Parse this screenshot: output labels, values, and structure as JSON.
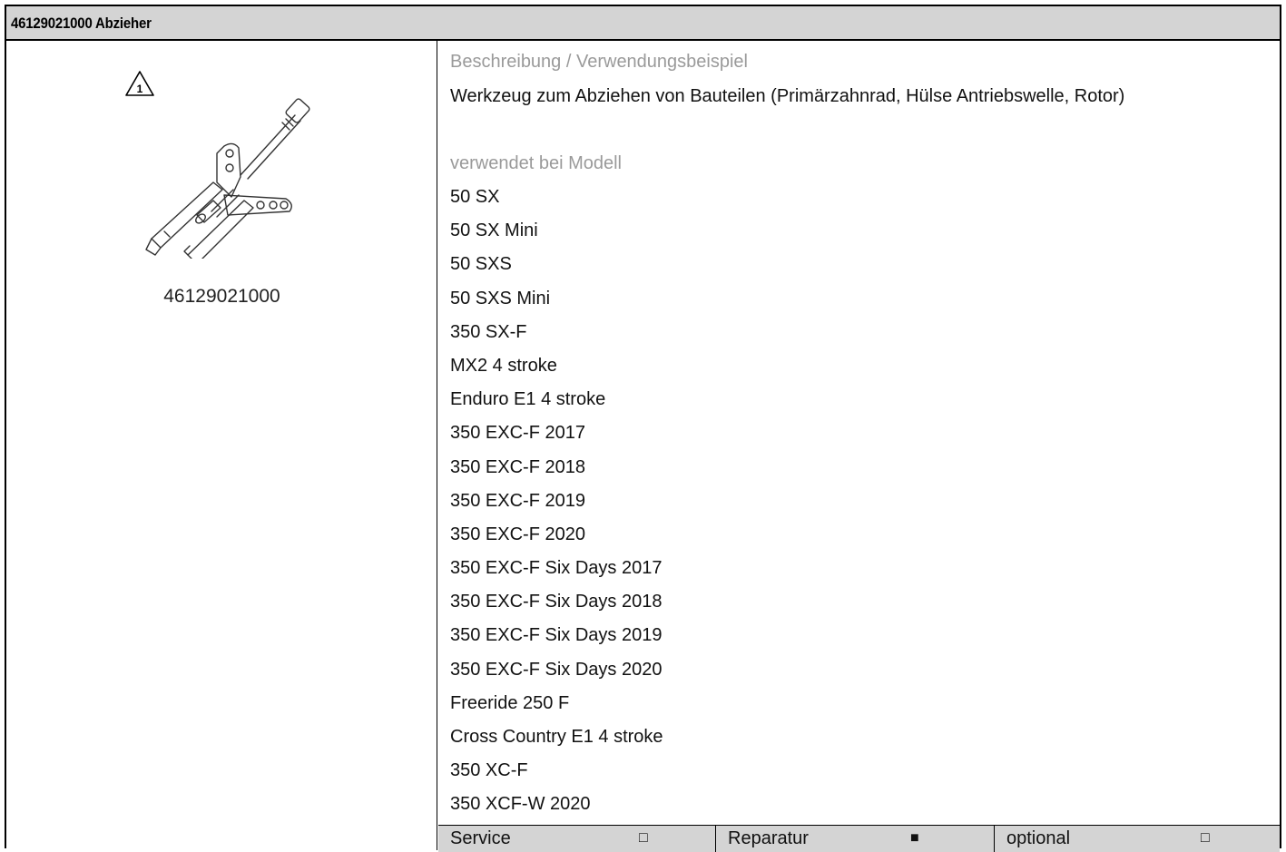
{
  "header": {
    "title": "46129021000 Abzieher"
  },
  "tool": {
    "image_icon": "puller-tool-illustration",
    "warning_icon": "warning-triangle-1-icon",
    "warning_number": "1",
    "part_number": "46129021000"
  },
  "description": {
    "label": "Beschreibung / Verwendungsbeispiel",
    "text": "Werkzeug zum Abziehen von Bauteilen (Primärzahnrad, Hülse Antriebswelle, Rotor)"
  },
  "models": {
    "label": "verwendet bei Modell",
    "items": [
      "50 SX",
      "50 SX Mini",
      "50 SXS",
      "50 SXS Mini",
      "350 SX-F",
      "MX2 4 stroke",
      "Enduro E1 4 stroke",
      "350 EXC-F 2017",
      "350 EXC-F 2018",
      "350 EXC-F 2019",
      "350 EXC-F 2020",
      "350 EXC-F Six Days 2017",
      "350 EXC-F Six Days 2018",
      "350 EXC-F Six Days 2019",
      "350 EXC-F Six Days 2020",
      "Freeride 250 F",
      "Cross Country E1 4 stroke",
      "350 XC-F",
      "350 XCF-W 2020"
    ]
  },
  "usage": {
    "service": {
      "label": "Service",
      "mark": "□",
      "checked": false
    },
    "reparatur": {
      "label": "Reparatur",
      "mark": "■",
      "checked": true
    },
    "optional": {
      "label": "optional",
      "mark": "□",
      "checked": false
    }
  }
}
